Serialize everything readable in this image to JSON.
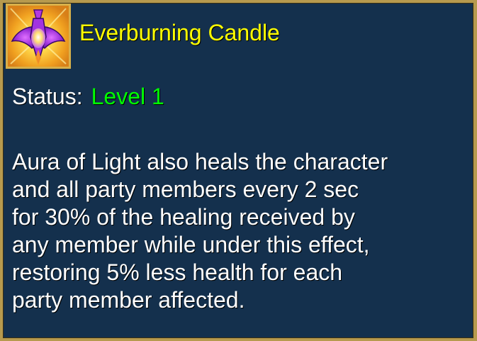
{
  "tooltip": {
    "icon": "everburning-candle-icon",
    "title": "Everburning Candle",
    "status_label": "Status:",
    "status_value": "Level 1",
    "description": "Aura of Light also heals the character\nand all party members every 2 sec\nfor 30% of the healing received by\nany member while under this effect,\nrestoring 5% less health for each\nparty member affected."
  },
  "colors": {
    "background": "#14304d",
    "border": "#b79a4e",
    "title": "#ffff00",
    "status_value": "#00ff00",
    "text": "#ffffff"
  }
}
